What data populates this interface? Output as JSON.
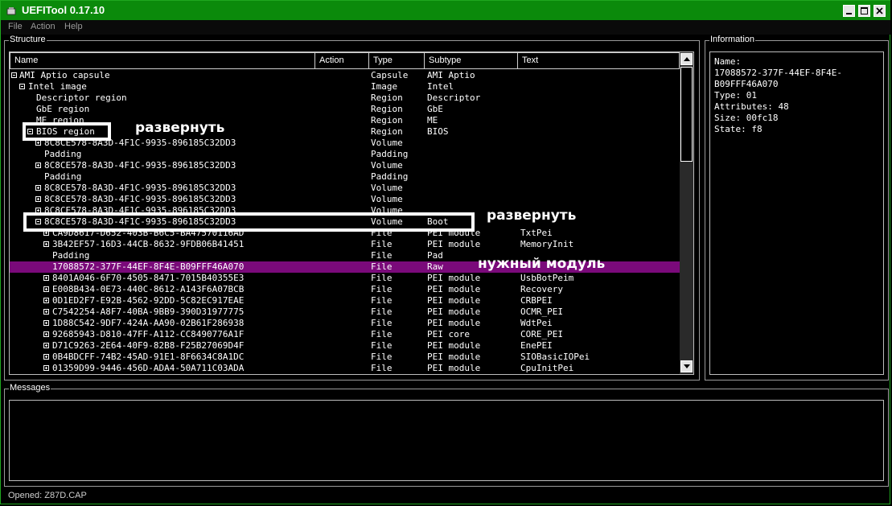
{
  "window": {
    "title": "UEFITool 0.17.10"
  },
  "menu": [
    "File",
    "Action",
    "Help"
  ],
  "structure": {
    "label": "Structure",
    "columns": [
      "Name",
      "Action",
      "Type",
      "Subtype",
      "Text"
    ],
    "rows": [
      {
        "name": "AMI Aptio capsule",
        "type": "Capsule",
        "subtype": "AMI Aptio",
        "text": "",
        "indent": 0,
        "toggle": "minus"
      },
      {
        "name": "Intel image",
        "type": "Image",
        "subtype": "Intel",
        "text": "",
        "indent": 1,
        "toggle": "minus"
      },
      {
        "name": "Descriptor region",
        "type": "Region",
        "subtype": "Descriptor",
        "text": "",
        "indent": 2,
        "toggle": ""
      },
      {
        "name": "GbE region",
        "type": "Region",
        "subtype": "GbE",
        "text": "",
        "indent": 2,
        "toggle": ""
      },
      {
        "name": "ME region",
        "type": "Region",
        "subtype": "ME",
        "text": "",
        "indent": 2,
        "toggle": ""
      },
      {
        "name": "BIOS region",
        "type": "Region",
        "subtype": "BIOS",
        "text": "",
        "indent": 2,
        "toggle": "minus"
      },
      {
        "name": "8C8CE578-8A3D-4F1C-9935-896185C32DD3",
        "type": "Volume",
        "subtype": "",
        "text": "",
        "indent": 3,
        "toggle": "plus"
      },
      {
        "name": "Padding",
        "type": "Padding",
        "subtype": "",
        "text": "",
        "indent": 3,
        "toggle": ""
      },
      {
        "name": "8C8CE578-8A3D-4F1C-9935-896185C32DD3",
        "type": "Volume",
        "subtype": "",
        "text": "",
        "indent": 3,
        "toggle": "plus"
      },
      {
        "name": "Padding",
        "type": "Padding",
        "subtype": "",
        "text": "",
        "indent": 3,
        "toggle": ""
      },
      {
        "name": "8C8CE578-8A3D-4F1C-9935-896185C32DD3",
        "type": "Volume",
        "subtype": "",
        "text": "",
        "indent": 3,
        "toggle": "plus"
      },
      {
        "name": "8C8CE578-8A3D-4F1C-9935-896185C32DD3",
        "type": "Volume",
        "subtype": "",
        "text": "",
        "indent": 3,
        "toggle": "plus"
      },
      {
        "name": "8C8CE578-8A3D-4F1C-9935-896185C32DD3",
        "type": "Volume",
        "subtype": "",
        "text": "",
        "indent": 3,
        "toggle": "plus"
      },
      {
        "name": "8C8CE578-8A3D-4F1C-9935-896185C32DD3",
        "type": "Volume",
        "subtype": "Boot",
        "text": "",
        "indent": 3,
        "toggle": "minus"
      },
      {
        "name": "CA9D8617-D652-403B-B6C5-BA47570116AD",
        "type": "File",
        "subtype": "PEI module",
        "text": "TxtPei",
        "indent": 4,
        "toggle": "plus"
      },
      {
        "name": "3B42EF57-16D3-44CB-8632-9FDB06B41451",
        "type": "File",
        "subtype": "PEI module",
        "text": "MemoryInit",
        "indent": 4,
        "toggle": "plus"
      },
      {
        "name": "Padding",
        "type": "File",
        "subtype": "Pad",
        "text": "",
        "indent": 4,
        "toggle": ""
      },
      {
        "name": "17088572-377F-44EF-8F4E-B09FFF46A070",
        "type": "File",
        "subtype": "Raw",
        "text": "",
        "indent": 5,
        "toggle": "",
        "selected": true
      },
      {
        "name": "8401A046-6F70-4505-8471-7015B40355E3",
        "type": "File",
        "subtype": "PEI module",
        "text": "UsbBotPeim",
        "indent": 4,
        "toggle": "plus"
      },
      {
        "name": "E008B434-0E73-440C-8612-A143F6A07BCB",
        "type": "File",
        "subtype": "PEI module",
        "text": "Recovery",
        "indent": 4,
        "toggle": "plus"
      },
      {
        "name": "0D1ED2F7-E92B-4562-92DD-5C82EC917EAE",
        "type": "File",
        "subtype": "PEI module",
        "text": "CRBPEI",
        "indent": 4,
        "toggle": "plus"
      },
      {
        "name": "C7542254-A8F7-40BA-9BB9-390D31977775",
        "type": "File",
        "subtype": "PEI module",
        "text": "OCMR_PEI",
        "indent": 4,
        "toggle": "plus"
      },
      {
        "name": "1D88C542-9DF7-424A-AA90-02B61F286938",
        "type": "File",
        "subtype": "PEI module",
        "text": "WdtPei",
        "indent": 4,
        "toggle": "plus"
      },
      {
        "name": "92685943-D810-47FF-A112-CC8490776A1F",
        "type": "File",
        "subtype": "PEI core",
        "text": "CORE_PEI",
        "indent": 4,
        "toggle": "plus"
      },
      {
        "name": "D71C9263-2E64-40F9-82B8-F25B27069D4F",
        "type": "File",
        "subtype": "PEI module",
        "text": "EnePEI",
        "indent": 4,
        "toggle": "plus"
      },
      {
        "name": "0B4BDCFF-74B2-45AD-91E1-8F6634C8A1DC",
        "type": "File",
        "subtype": "PEI module",
        "text": "SIOBasicIOPei",
        "indent": 4,
        "toggle": "plus"
      },
      {
        "name": "01359D99-9446-456D-ADA4-50A711C03ADA",
        "type": "File",
        "subtype": "PEI module",
        "text": "CpuInitPei",
        "indent": 4,
        "toggle": "plus"
      }
    ]
  },
  "information": {
    "label": "Information",
    "lines": [
      "Name:",
      "17088572-377F-44EF-8F4E-",
      "B09FFF46A070",
      "Type: 01",
      "Attributes: 48",
      "Size: 00fc18",
      "State: f8"
    ]
  },
  "messages": {
    "label": "Messages"
  },
  "status": "Opened: Z87D.CAP",
  "annotations": {
    "expand_1": "развернуть",
    "expand_2": "развернуть",
    "target": "нужный модуль"
  },
  "colors": {
    "titlebar": "#0b8a0b",
    "selected_row": "#7a0a7a",
    "frame": "#1fa81f"
  }
}
